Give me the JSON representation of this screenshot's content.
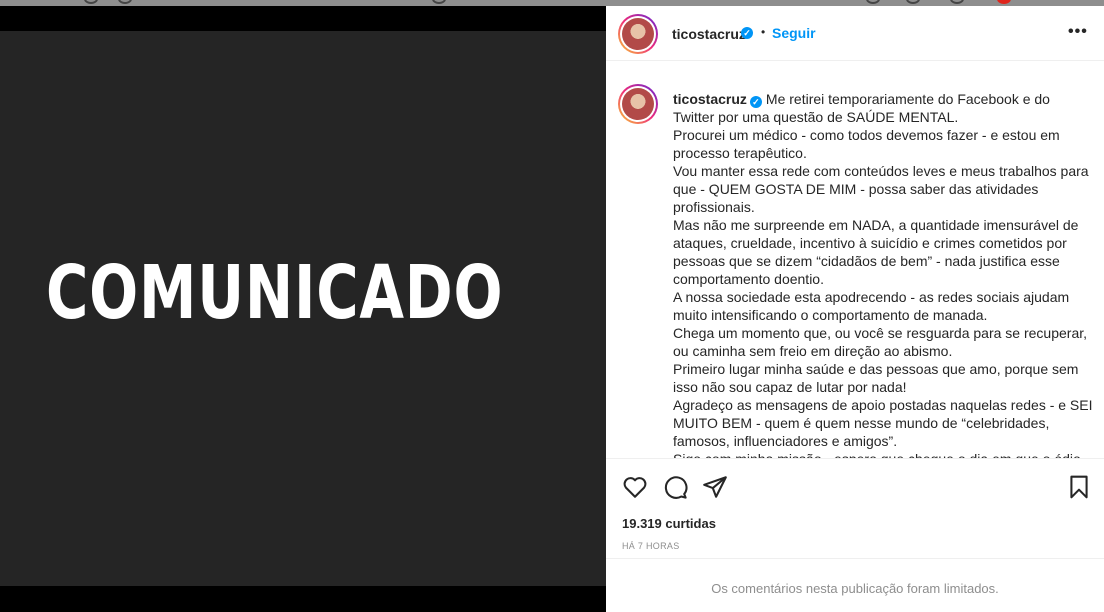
{
  "media": {
    "headline": "COMUNICADO"
  },
  "post": {
    "username": "ticostacruz",
    "verified_mark": "✓",
    "separator": "•",
    "follow_label": "Seguir",
    "more_label": "•••",
    "caption_first": "Me retirei temporariamente do Facebook e do Twitter por uma questão de SAÚDE MENTAL.",
    "caption_lines": [
      "Procurei um médico - como todos devemos fazer - e estou em processo terapêutico.",
      "Vou manter essa rede com conteúdos leves e meus trabalhos para que - QUEM GOSTA DE MIM - possa saber das atividades profissionais.",
      "Mas não me surpreende em NADA, a quantidade imensurável de ataques, crueldade, incentivo à suicídio e crimes cometidos por pessoas que se dizem “cidadãos de bem” - nada justifica esse comportamento doentio.",
      "A nossa sociedade esta apodrecendo - as redes sociais ajudam muito intensificando o comportamento de manada.",
      "Chega um momento que, ou você se resguarda para se recuperar, ou caminha sem freio em direção ao abismo.",
      "Primeiro lugar minha saúde e das pessoas que amo, porque sem isso não sou capaz de lutar por nada!",
      "Agradeço as mensagens de apoio postadas naquelas redes - e SEI MUITO BEM - quem é quem nesse mundo de “celebridades, famosos, influenciadores e amigos”.",
      "Sigo com minha missão - espero que chegue o dia em que o ódio"
    ],
    "likes": "19.319 curtidas",
    "time": "HÁ 7 HORAS",
    "comments_limited": "Os comentários nesta publicação foram limitados."
  },
  "icons": {
    "like": "heart-icon",
    "comment": "comment-icon",
    "share": "send-icon",
    "save": "bookmark-icon"
  },
  "colors": {
    "accent": "#0095f6",
    "text": "#262626",
    "muted": "#8e8e8e",
    "media_bg": "#252525"
  }
}
